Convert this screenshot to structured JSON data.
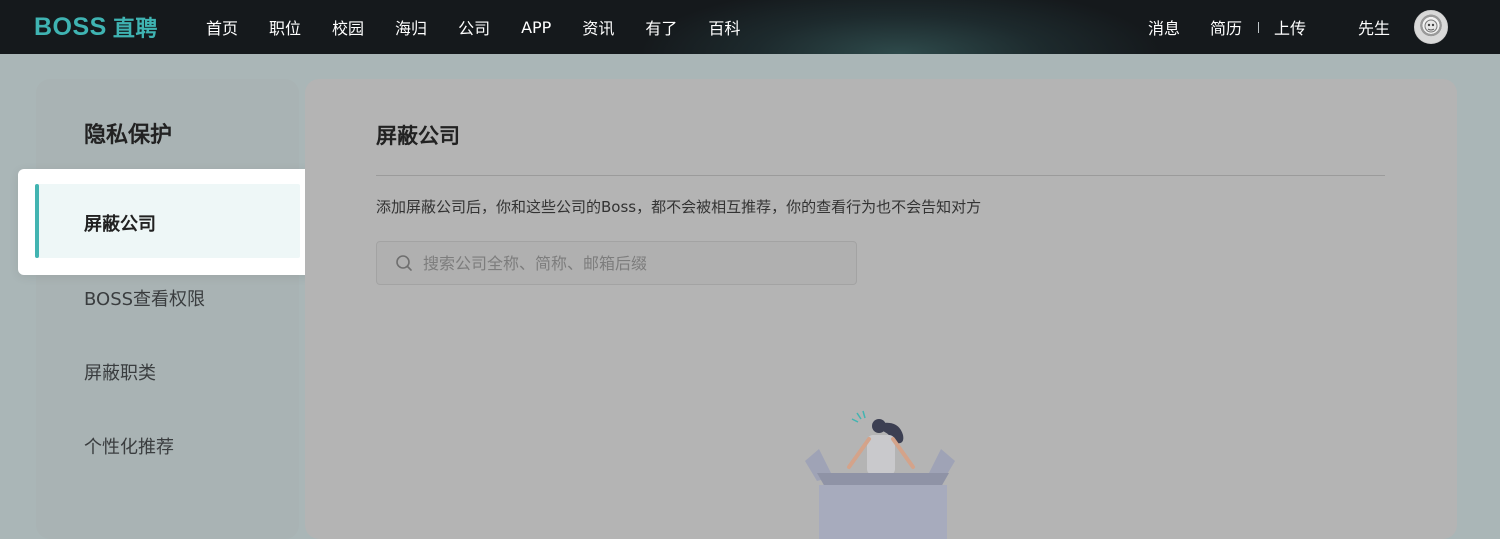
{
  "header": {
    "logo_text": "BOSS",
    "logo_cn": "直聘",
    "nav": [
      "首页",
      "职位",
      "校园",
      "海归",
      "公司",
      "APP",
      "资讯",
      "有了",
      "百科"
    ],
    "right": {
      "messages": "消息",
      "resume": "简历",
      "upload": "上传",
      "user_name": "先生"
    }
  },
  "sidebar": {
    "title": "隐私保护",
    "items": [
      {
        "label": "屏蔽公司",
        "active": true
      },
      {
        "label": "BOSS查看权限",
        "active": false
      },
      {
        "label": "屏蔽职类",
        "active": false
      },
      {
        "label": "个性化推荐",
        "active": false
      }
    ]
  },
  "main": {
    "title": "屏蔽公司",
    "description": "添加屏蔽公司后，你和这些公司的Boss，都不会被相互推荐，你的查看行为也不会告知对方",
    "search": {
      "placeholder": "搜索公司全称、简称、邮箱后缀",
      "value": ""
    }
  },
  "colors": {
    "accent": "#42b4b1",
    "topbar": "#1d2a2d",
    "overlay_bg": "#aab6b7"
  },
  "icons": {
    "search": "search-icon",
    "avatar": "avatar",
    "empty_state": "empty-box-illustration"
  }
}
